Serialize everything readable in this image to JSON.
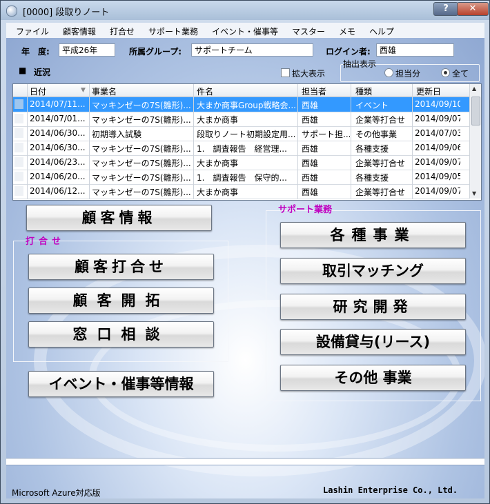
{
  "window": {
    "title": "[0000]  段取りノート",
    "help_label": "?",
    "close_label": "✕"
  },
  "menu": [
    "ファイル",
    "顧客情報",
    "打合せ",
    "サポート業務",
    "イベント・催事等",
    "マスター",
    "メモ",
    "ヘルプ"
  ],
  "filters": {
    "year_label": "年　度:",
    "year_value": "平成26年",
    "group_label": "所属グループ:",
    "group_value": "サポートチーム",
    "login_label": "ログイン者:",
    "login_value": "西雄"
  },
  "recent": {
    "label": "近況",
    "bullet": "■",
    "zoom_label": "拡大表示",
    "extract_label": "抽出表示",
    "opt_mine": "担当分",
    "opt_all": "全て",
    "selected": "全て"
  },
  "grid": {
    "columns": [
      "日付",
      "事業名",
      "件名",
      "担当者",
      "種類",
      "更新日"
    ],
    "rows": [
      [
        "2014/07/11...",
        "マッキンゼーの7S(雛形)...",
        "大まか商事Group戦略会...",
        "西雄",
        "イベント",
        "2014/09/10..."
      ],
      [
        "2014/07/01...",
        "マッキンゼーの7S(雛形)...",
        "大まか商事",
        "西雄",
        "企業等打合せ",
        "2014/09/07..."
      ],
      [
        "2014/06/30...",
        "初期導入試験",
        "段取りノート初期設定用...",
        "サポート担...",
        "その他事業",
        "2014/07/03..."
      ],
      [
        "2014/06/30...",
        "マッキンゼーの7S(雛形)...",
        "1.　調査報告　経営理...",
        "西雄",
        "各種支援",
        "2014/09/06..."
      ],
      [
        "2014/06/23...",
        "マッキンゼーの7S(雛形)...",
        "大まか商事",
        "西雄",
        "企業等打合せ",
        "2014/09/07..."
      ],
      [
        "2014/06/20...",
        "マッキンゼーの7S(雛形)...",
        "1.　調査報告　保守的...",
        "西雄",
        "各種支援",
        "2014/09/05..."
      ],
      [
        "2014/06/12...",
        "マッキンゼーの7S(雛形)...",
        "大まか商事",
        "西雄",
        "企業等打合せ",
        "2014/09/07..."
      ]
    ]
  },
  "buttons": {
    "customer_info": "顧客情報",
    "meeting_group": "打合せ",
    "customer_meeting": "顧客打合せ",
    "customer_dev": "顧客開拓",
    "consult": "窓口相談",
    "event_info": "イベント・催事等情報",
    "support_group": "サポート業務",
    "various": "各種事業",
    "matching": "取引マッチング",
    "research": "研究開発",
    "lease": "設備貸与(リース)",
    "other": "その他 事業"
  },
  "footer": {
    "left": "Microsoft Azure対応版",
    "right": "Lashin Enterprise Co., Ltd."
  }
}
